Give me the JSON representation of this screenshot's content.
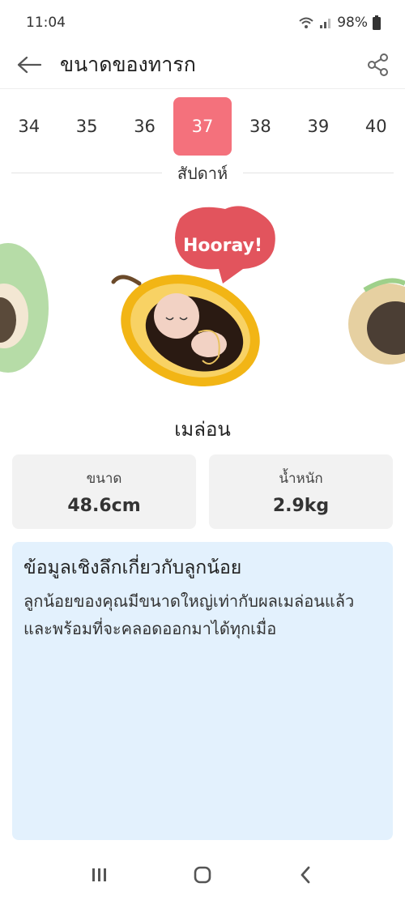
{
  "status": {
    "time": "11:04",
    "battery": "98%"
  },
  "appbar": {
    "title": "ขนาดของทารก"
  },
  "weeks": [
    "34",
    "35",
    "36",
    "37",
    "38",
    "39",
    "40"
  ],
  "active_week": "37",
  "week_unit": "สัปดาห์",
  "illustration": {
    "badge_text": "Hooray!"
  },
  "fruit_name": "เมล่อน",
  "stats": {
    "size_label": "ขนาด",
    "size_value": "48.6cm",
    "weight_label": "น้ำหนัก",
    "weight_value": "2.9kg"
  },
  "insight": {
    "heading": "ข้อมูลเชิงลึกเกี่ยวกับลูกน้อย",
    "body": "ลูกน้อยของคุณมีขนาดใหญ่เท่ากับผลเมล่อนแล้ว และพร้อมที่จะคลอดออกมาได้ทุกเมื่อ"
  },
  "colors": {
    "accent": "#f4717c",
    "insight_bg": "#e3f1fd",
    "card_bg": "#f2f2f2"
  }
}
